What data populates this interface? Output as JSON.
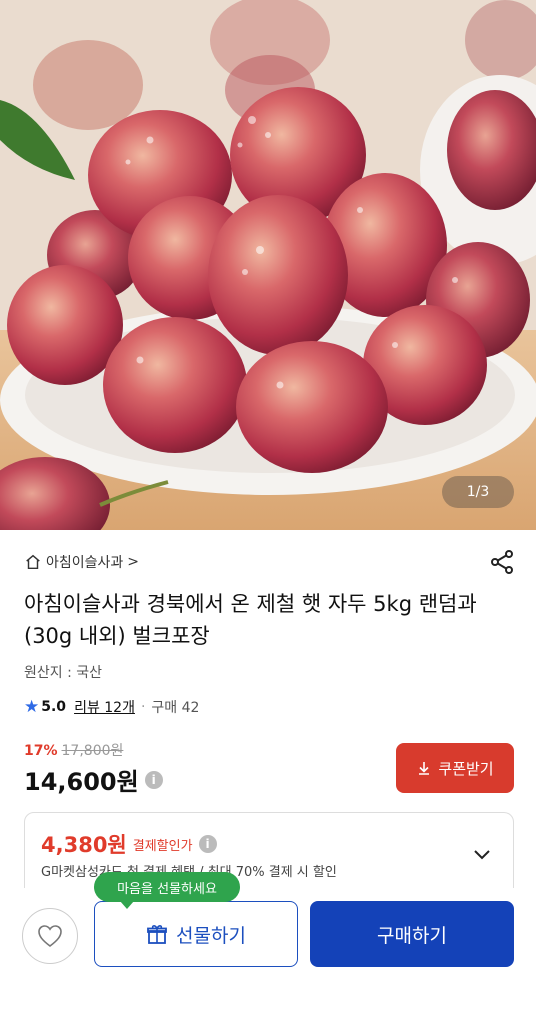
{
  "gallery": {
    "counter": "1/3"
  },
  "store": {
    "name": "아침이슬사과",
    "chevron": ">"
  },
  "product": {
    "title": "아침이슬사과 경북에서 온 제철 햇 자두 5kg 랜덤과(30g 내외) 벌크포장",
    "origin": "원산지 : 국산"
  },
  "rating": {
    "score": "5.0",
    "review": "리뷰 12개",
    "separator": "·",
    "purchase": "구매 42"
  },
  "price": {
    "discount": "17%",
    "original": "17,800원",
    "current": "14,600원",
    "info": "i"
  },
  "coupon": {
    "label": "쿠폰받기"
  },
  "card_offer": {
    "price": "4,380원",
    "label": "결제할인가",
    "info": "i",
    "desc": "G마켓삼성카드 첫 결제 혜택 / 최대 70% 결제 시 할인"
  },
  "bottom": {
    "tooltip": "마음을 선물하세요",
    "gift_label": "선물하기",
    "buy_label": "구매하기"
  },
  "colors": {
    "accent_blue": "#1442b8",
    "sale_red": "#e03b2b",
    "coupon_red": "#d83b2d",
    "tooltip_green": "#2fa44d"
  },
  "icons": [
    "home-icon",
    "share-icon",
    "star-icon",
    "info-icon",
    "download-icon",
    "chevron-down-icon",
    "heart-icon",
    "gift-icon"
  ]
}
